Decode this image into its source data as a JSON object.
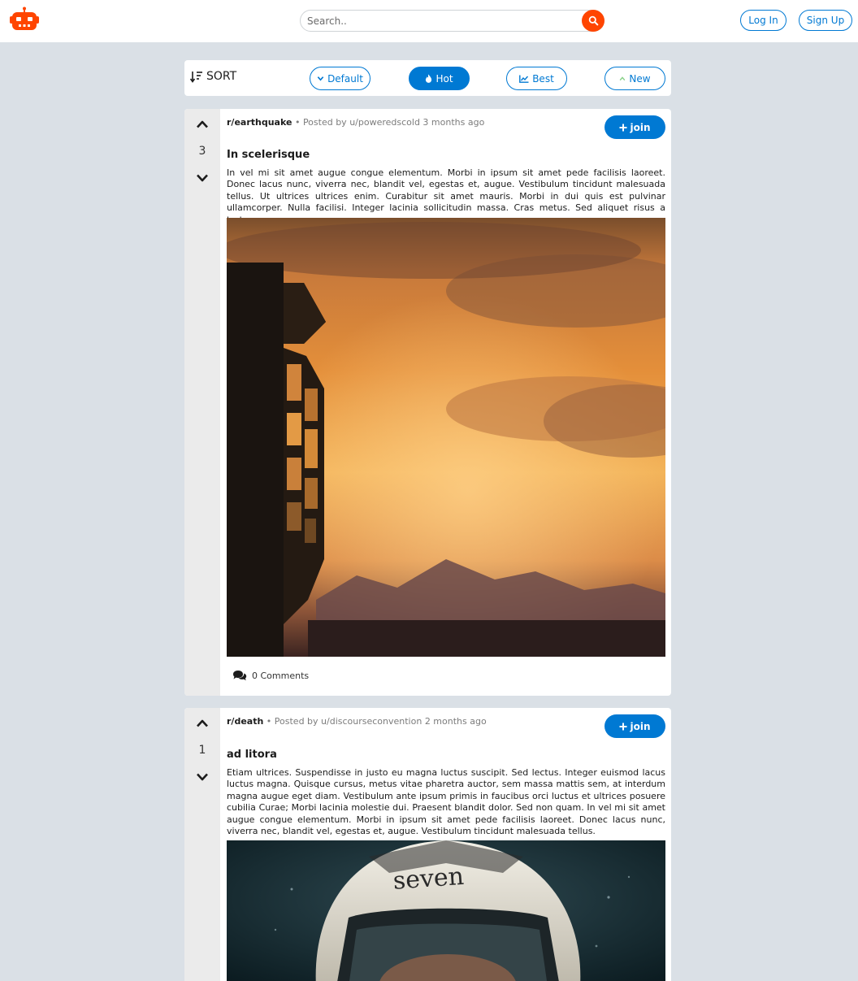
{
  "header": {
    "logo_icon": "robot-icon",
    "search_placeholder": "Search..",
    "login_label": "Log In",
    "signup_label": "Sign Up"
  },
  "sort": {
    "title": "SORT",
    "options": [
      {
        "label": "Default",
        "icon": "chevron-down-icon"
      },
      {
        "label": "Hot",
        "icon": "fire-icon",
        "active": true
      },
      {
        "label": "Best",
        "icon": "chart-line-icon"
      },
      {
        "label": "New",
        "icon": "chevron-up-icon"
      }
    ]
  },
  "posts": [
    {
      "votes": "3",
      "subreddit": "r/earthquake",
      "posted_by": "• Posted by u/poweredscold 3 months ago",
      "join_label": "join",
      "title": "In scelerisque",
      "body": "In vel mi sit amet augue congue elementum. Morbi in ipsum sit amet pede facilisis laoreet. Donec lacus nunc, viverra nec, blandit vel, egestas et, augue. Vestibulum tincidunt malesuada tellus. Ut ultrices ultrices enim. Curabitur sit amet mauris. Morbi in dui quis est pulvinar ullamcorper. Nulla facilisi. Integer lacinia sollicitudin massa. Cras metus. Sed aliquet risus a tortor.",
      "image": "sunset-building-photo",
      "comments": "0 Comments"
    },
    {
      "votes": "1",
      "subreddit": "r/death",
      "posted_by": "• Posted by u/discourseconvention 2 months ago",
      "join_label": "join",
      "title": "ad litora",
      "body": "Etiam ultrices. Suspendisse in justo eu magna luctus suscipit. Sed lectus. Integer euismod lacus luctus magna. Quisque cursus, metus vitae pharetra auctor, sem massa mattis sem, at interdum magna augue eget diam. Vestibulum ante ipsum primis in faucibus orci luctus et ultrices posuere cubilia Curae; Morbi lacinia molestie dui. Praesent blandit dolor. Sed non quam. In vel mi sit amet augue congue elementum. Morbi in ipsum sit amet pede facilisis laoreet. Donec lacus nunc, viverra nec, blandit vel, egestas et, augue. Vestibulum tincidunt malesuada tellus.",
      "image": "helmet-rider-photo",
      "helmet_text": "seven"
    }
  ],
  "colors": {
    "brand_orange": "#ff4500",
    "accent_blue": "#0079d3",
    "page_bg": "#dae0e6"
  }
}
